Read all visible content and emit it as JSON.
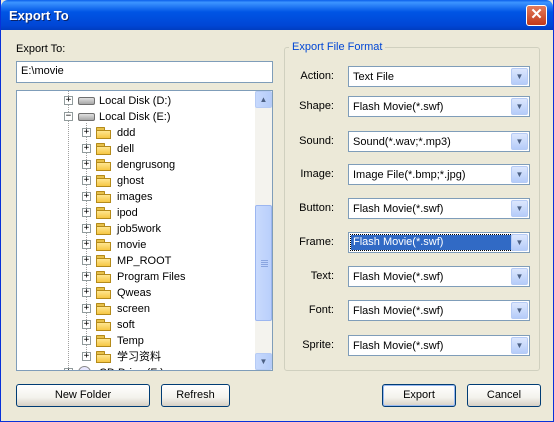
{
  "window": {
    "title": "Export To",
    "close_glyph": "✕"
  },
  "left": {
    "export_to_label": "Export To:",
    "path_value": "E:\\movie",
    "tree": [
      {
        "label": "Local Disk (D:)",
        "icon": "hard-disk-icon",
        "expander": "+"
      },
      {
        "label": "Local Disk (E:)",
        "icon": "hard-disk-icon",
        "expander": "−"
      },
      {
        "label": "ddd",
        "icon": "folder-icon",
        "expander": "+"
      },
      {
        "label": "dell",
        "icon": "folder-icon",
        "expander": "+"
      },
      {
        "label": "dengrusong",
        "icon": "folder-icon",
        "expander": "+"
      },
      {
        "label": "ghost",
        "icon": "folder-icon",
        "expander": "+"
      },
      {
        "label": "images",
        "icon": "folder-icon",
        "expander": "+"
      },
      {
        "label": "ipod",
        "icon": "folder-icon",
        "expander": "+"
      },
      {
        "label": "job5work",
        "icon": "folder-icon",
        "expander": "+"
      },
      {
        "label": "movie",
        "icon": "folder-icon",
        "expander": "+"
      },
      {
        "label": "MP_ROOT",
        "icon": "folder-icon",
        "expander": "+"
      },
      {
        "label": "Program Files",
        "icon": "folder-icon",
        "expander": "+"
      },
      {
        "label": "Qweas",
        "icon": "folder-icon",
        "expander": "+"
      },
      {
        "label": "screen",
        "icon": "folder-icon",
        "expander": "+"
      },
      {
        "label": "soft",
        "icon": "folder-icon",
        "expander": "+"
      },
      {
        "label": "Temp",
        "icon": "folder-icon",
        "expander": "+"
      },
      {
        "label": "学习资料",
        "icon": "folder-icon",
        "expander": "+"
      },
      {
        "label": "CD Drive (F:)",
        "icon": "cd-drive-icon",
        "expander": "+"
      }
    ],
    "scroll_up_glyph": "▲",
    "scroll_down_glyph": "▼",
    "new_folder_label": "New Folder",
    "refresh_label": "Refresh"
  },
  "right": {
    "group_title": "Export File Format",
    "fields": [
      {
        "label": "Action:",
        "value": "Text File"
      },
      {
        "label": "Shape:",
        "value": "Flash Movie(*.swf)"
      },
      {
        "label": "Sound:",
        "value": "Sound(*.wav;*.mp3)"
      },
      {
        "label": "Image:",
        "value": "Image File(*.bmp;*.jpg)"
      },
      {
        "label": "Button:",
        "value": "Flash Movie(*.swf)"
      },
      {
        "label": "Frame:",
        "value": "Flash Movie(*.swf)"
      },
      {
        "label": "Text:",
        "value": "Flash Movie(*.swf)"
      },
      {
        "label": "Font:",
        "value": "Flash Movie(*.swf)"
      },
      {
        "label": "Sprite:",
        "value": "Flash Movie(*.swf)"
      }
    ],
    "dropdown_glyph": "▼",
    "export_label": "Export",
    "cancel_label": "Cancel"
  },
  "colors": {
    "accent": "#0046D5",
    "selection": "#316AC5",
    "title_bar": "#0055E5",
    "dialog_bg": "#ECE9D8"
  }
}
